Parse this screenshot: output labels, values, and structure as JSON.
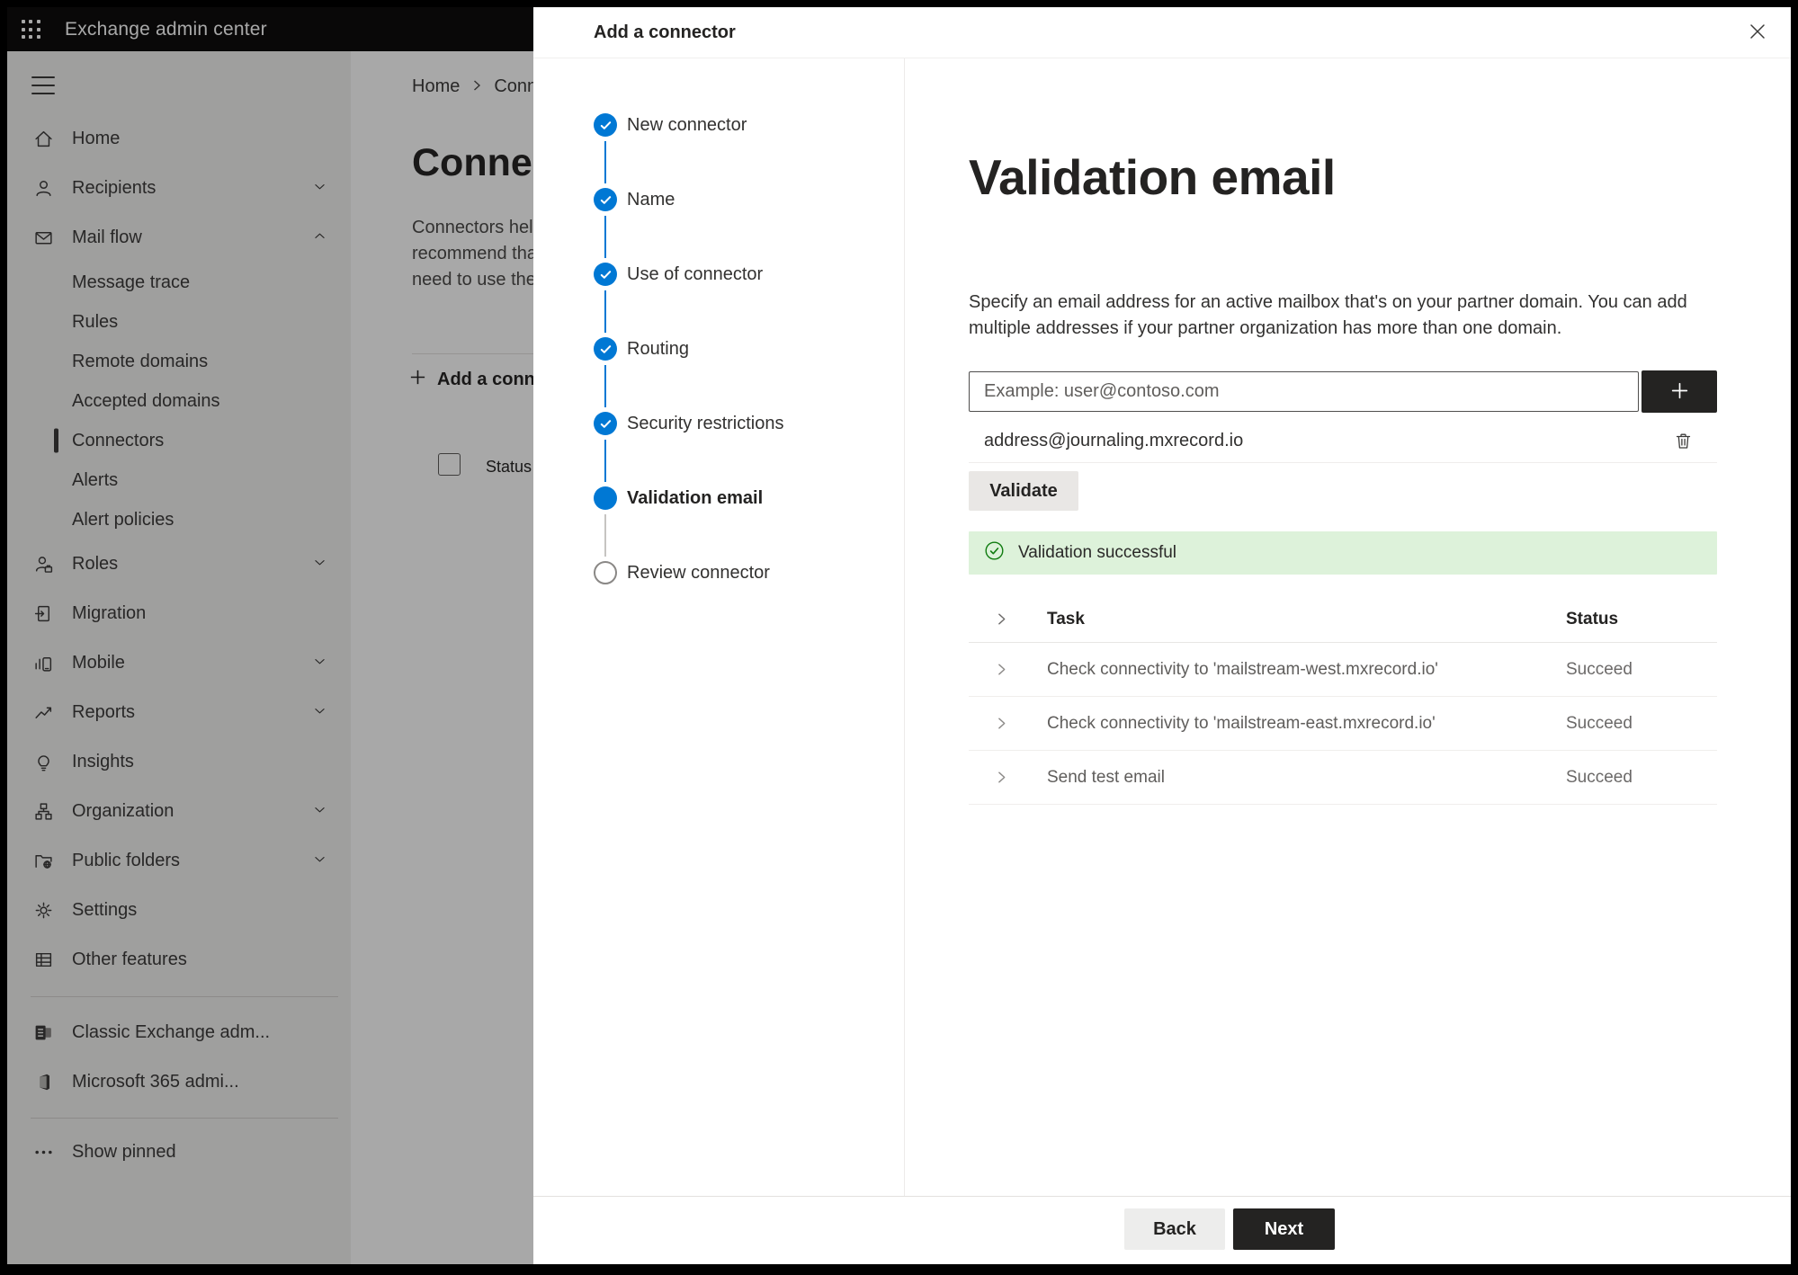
{
  "topbar": {
    "title": "Exchange admin center"
  },
  "sidebar": {
    "items": [
      {
        "label": "Home"
      },
      {
        "label": "Recipients",
        "chevron": "down"
      },
      {
        "label": "Mail flow",
        "chevron": "up"
      },
      {
        "label": "Message trace",
        "sub": true
      },
      {
        "label": "Rules",
        "sub": true
      },
      {
        "label": "Remote domains",
        "sub": true
      },
      {
        "label": "Accepted domains",
        "sub": true
      },
      {
        "label": "Connectors",
        "sub": true,
        "selected": true
      },
      {
        "label": "Alerts",
        "sub": true
      },
      {
        "label": "Alert policies",
        "sub": true
      },
      {
        "label": "Roles",
        "chevron": "down"
      },
      {
        "label": "Migration"
      },
      {
        "label": "Mobile",
        "chevron": "down"
      },
      {
        "label": "Reports",
        "chevron": "down"
      },
      {
        "label": "Insights"
      },
      {
        "label": "Organization",
        "chevron": "down"
      },
      {
        "label": "Public folders",
        "chevron": "down"
      },
      {
        "label": "Settings"
      },
      {
        "label": "Other features"
      },
      {
        "label": "Classic Exchange adm..."
      },
      {
        "label": "Microsoft 365 admi..."
      },
      {
        "label": "Show pinned"
      }
    ]
  },
  "page": {
    "breadcrumb_home": "Home",
    "breadcrumb_current": "Conne",
    "title": "Connect",
    "desc_lines": [
      "Connectors help",
      "recommend tha",
      "need to use ther"
    ],
    "add_button": "Add a conn",
    "status_header": "Status"
  },
  "modal": {
    "title": "Add a connector",
    "steps": [
      {
        "label": "New connector",
        "state": "done"
      },
      {
        "label": "Name",
        "state": "done"
      },
      {
        "label": "Use of connector",
        "state": "done"
      },
      {
        "label": "Routing",
        "state": "done"
      },
      {
        "label": "Security restrictions",
        "state": "done"
      },
      {
        "label": "Validation email",
        "state": "current"
      },
      {
        "label": "Review connector",
        "state": "pending"
      }
    ],
    "content": {
      "heading": "Validation email",
      "description": "Specify an email address for an active mailbox that's on your partner domain. You can add multiple addresses if your partner organization has more than one domain.",
      "input_placeholder": "Example: user@contoso.com",
      "address": "address@journaling.mxrecord.io",
      "validate_button": "Validate",
      "banner_text": "Validation successful",
      "table": {
        "col_task": "Task",
        "col_status": "Status",
        "rows": [
          {
            "task": "Check connectivity to 'mailstream-west.mxrecord.io'",
            "status": "Succeed"
          },
          {
            "task": "Check connectivity to 'mailstream-east.mxrecord.io'",
            "status": "Succeed"
          },
          {
            "task": "Send test email",
            "status": "Succeed"
          }
        ]
      }
    },
    "footer": {
      "back": "Back",
      "next": "Next"
    }
  },
  "icons": {
    "app-launcher": "3x3-dot-grid",
    "step-done": "blue-circle-white-check",
    "step-current": "blue-filled-circle",
    "step-pending": "gray-outline-circle",
    "success": "green-circle-check",
    "delete": "trash-outline",
    "add": "plus",
    "row-expand": "chevron-right"
  },
  "colors": {
    "accent_blue": "#0078d4",
    "success_bg": "#ddf2da",
    "success_green": "#107c10",
    "dark_button": "#242322",
    "light_button": "#e9e7e5",
    "topbar_bg": "#0b0a0a"
  }
}
